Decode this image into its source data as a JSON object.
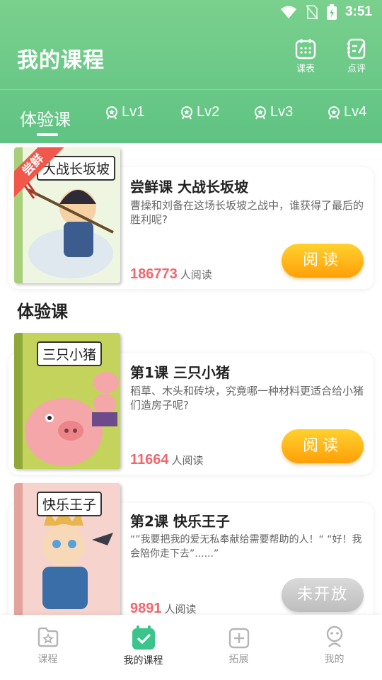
{
  "status_bar": {
    "time": "3:51"
  },
  "header": {
    "title": "我的课程",
    "schedule_label": "课表",
    "review_label": "点评"
  },
  "level_tabs": [
    {
      "label": "体验课",
      "active": true
    },
    {
      "label": "Lv1",
      "active": false
    },
    {
      "label": "Lv2",
      "active": false
    },
    {
      "label": "Lv3",
      "active": false
    },
    {
      "label": "Lv4",
      "active": false
    }
  ],
  "featured": {
    "badge": "尝鲜",
    "cover_title": "大战长坂坡",
    "name": "尝鲜课  大战长坂坡",
    "description": "曹操和刘备在这场长坂坡之战中，谁获得了最后的胜利呢?",
    "read_count": "186773",
    "read_unit": "人阅读",
    "button": "阅读"
  },
  "section_title": "体验课",
  "courses": [
    {
      "cover_title": "三只小猪",
      "name": "第1课  三只小猪",
      "description": "稻草、木头和砖块，究竟哪一种材料更适合给小猪们造房子呢?",
      "read_count": "11664",
      "read_unit": "人阅读",
      "button": "阅读"
    },
    {
      "cover_title": "快乐王子",
      "name": "第2课  快乐王子",
      "description": "“”我要把我的爱无私奉献给需要帮助的人！“ “好！我会陪你走下去”......”",
      "read_count": "9891",
      "read_unit": "人阅读",
      "button": "未开放"
    }
  ],
  "bottom_nav": [
    {
      "label": "课程",
      "active": false
    },
    {
      "label": "我的课程",
      "active": true
    },
    {
      "label": "拓展",
      "active": false
    },
    {
      "label": "我的",
      "active": false
    }
  ],
  "colors": {
    "header_green": "#6ccb88",
    "read_button": "#ffb71a",
    "count_red": "#f0676e",
    "active_nav": "#3cc48d"
  }
}
